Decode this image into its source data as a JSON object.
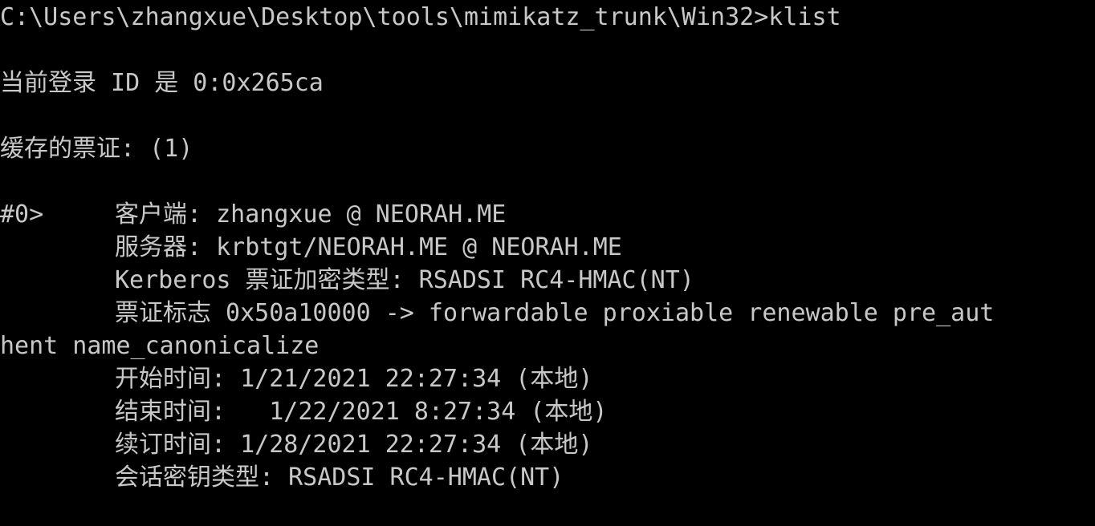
{
  "console": {
    "prompt_line": "C:\\Users\\zhangxue\\Desktop\\tools\\mimikatz_trunk\\Win32>klist",
    "logon_id": "当前登录 ID 是 0:0x265ca",
    "cached_tickets": "缓存的票证: (1)",
    "ticket": {
      "index": "#0>",
      "client": "客户端: zhangxue @ NEORAH.ME",
      "server": "服务器: krbtgt/NEORAH.ME @ NEORAH.ME",
      "encryption_type": "Kerberos 票证加密类型: RSADSI RC4-HMAC(NT)",
      "flags_part1": "票证标志 0x50a10000 -> forwardable proxiable renewable pre_aut",
      "flags_part2": "hent name_canonicalize",
      "start_time": "开始时间: 1/21/2021 22:27:34 (本地)",
      "end_time": "结束时间:   1/22/2021 8:27:34 (本地)",
      "renew_time": "续订时间: 1/28/2021 22:27:34 (本地)",
      "session_key_type": "会话密钥类型: RSADSI RC4-HMAC(NT)"
    }
  }
}
